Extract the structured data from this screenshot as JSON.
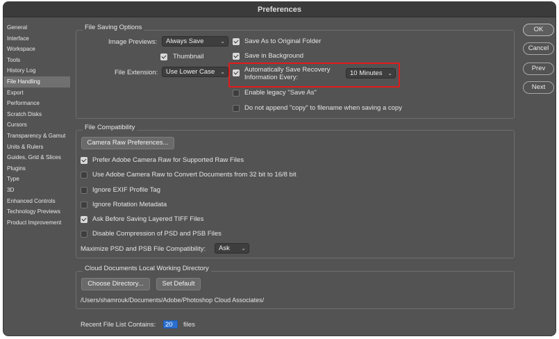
{
  "window": {
    "title": "Preferences"
  },
  "sidebar": {
    "items": [
      {
        "label": "General"
      },
      {
        "label": "Interface"
      },
      {
        "label": "Workspace"
      },
      {
        "label": "Tools"
      },
      {
        "label": "History Log"
      },
      {
        "label": "File Handling",
        "selected": true
      },
      {
        "label": "Export"
      },
      {
        "label": "Performance"
      },
      {
        "label": "Scratch Disks"
      },
      {
        "label": "Cursors"
      },
      {
        "label": "Transparency & Gamut"
      },
      {
        "label": "Units & Rulers"
      },
      {
        "label": "Guides, Grid & Slices"
      },
      {
        "label": "Plugins"
      },
      {
        "label": "Type"
      },
      {
        "label": "3D"
      },
      {
        "label": "Enhanced Controls"
      },
      {
        "label": "Technology Previews"
      },
      {
        "label": "Product Improvement"
      }
    ]
  },
  "buttons": {
    "ok": "OK",
    "cancel": "Cancel",
    "prev": "Prev",
    "next": "Next"
  },
  "file_saving": {
    "title": "File Saving Options",
    "image_previews_label": "Image Previews:",
    "image_previews_value": "Always Save",
    "thumbnail_label": "Thumbnail",
    "file_extension_label": "File Extension:",
    "file_extension_value": "Use Lower Case",
    "save_as_original": "Save As to Original Folder",
    "save_in_background": "Save in Background",
    "auto_save_line1": "Automatically Save Recovery",
    "auto_save_line2": "Information Every:",
    "auto_save_interval": "10 Minutes",
    "legacy_save_as": "Enable legacy \"Save As\"",
    "no_copy": "Do not append \"copy\" to filename when saving a copy"
  },
  "file_compat": {
    "title": "File Compatibility",
    "camera_raw_button": "Camera Raw Preferences...",
    "prefer_acr": "Prefer Adobe Camera Raw for Supported Raw Files",
    "use_acr_convert": "Use Adobe Camera Raw to Convert Documents from 32 bit to 16/8 bit",
    "ignore_exif": "Ignore EXIF Profile Tag",
    "ignore_rotation": "Ignore Rotation Metadata",
    "ask_tiff": "Ask Before Saving Layered TIFF Files",
    "disable_compression": "Disable Compression of PSD and PSB Files",
    "maximize_label": "Maximize PSD and PSB File Compatibility:",
    "maximize_value": "Ask"
  },
  "cloud": {
    "title": "Cloud Documents Local Working Directory",
    "choose_button": "Choose Directory...",
    "set_default_button": "Set Default",
    "path": "/Users/shamrouk/Documents/Adobe/Photoshop Cloud Associates/"
  },
  "recent": {
    "label": "Recent File List Contains:",
    "value": "20",
    "suffix": "files"
  },
  "colors": {
    "window_bg": "#535353",
    "highlight": "#e21b1b",
    "input_accent": "#2b6fd0"
  }
}
